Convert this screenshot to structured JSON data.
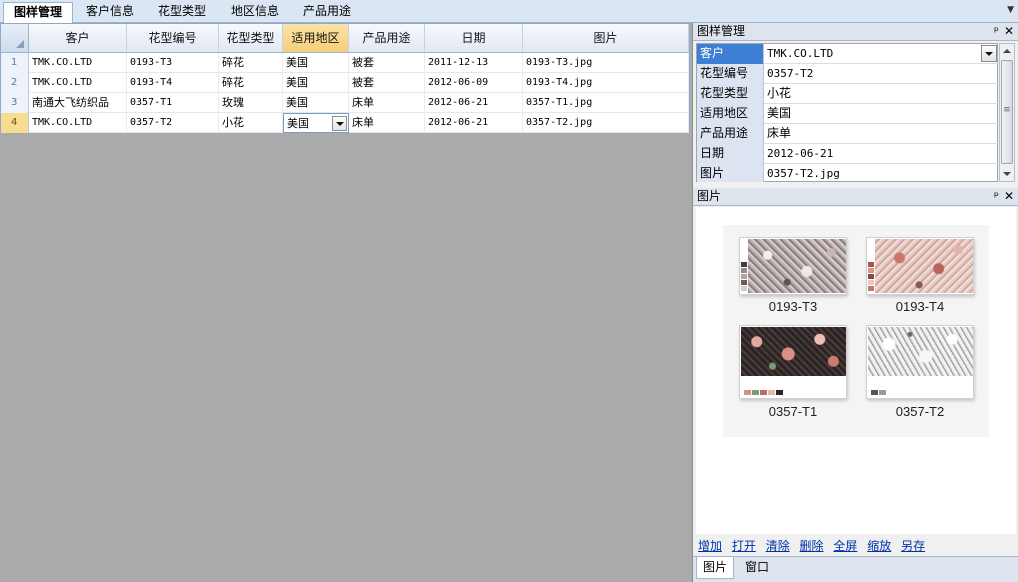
{
  "tabs": [
    {
      "label": "图样管理",
      "active": true
    },
    {
      "label": "客户信息",
      "active": false
    },
    {
      "label": "花型类型",
      "active": false
    },
    {
      "label": "地区信息",
      "active": false
    },
    {
      "label": "产品用途",
      "active": false
    }
  ],
  "tab_menu_icon": "chevron-down-icon",
  "grid": {
    "columns": [
      "客户",
      "花型编号",
      "花型类型",
      "适用地区",
      "产品用途",
      "日期",
      "图片"
    ],
    "selected_column": "适用地区",
    "current_row": 4,
    "rows": [
      {
        "num": "1",
        "cells": [
          "TMK.CO.LTD",
          "0193-T3",
          "碎花",
          "美国",
          "被套",
          "2011-12-13",
          "0193-T3.jpg"
        ]
      },
      {
        "num": "2",
        "cells": [
          "TMK.CO.LTD",
          "0193-T4",
          "碎花",
          "美国",
          "被套",
          "2012-06-09",
          "0193-T4.jpg"
        ]
      },
      {
        "num": "3",
        "cells": [
          "南通大飞纺织品",
          "0357-T1",
          "玫瑰",
          "美国",
          "床单",
          "2012-06-21",
          "0357-T1.jpg"
        ]
      },
      {
        "num": "4",
        "cells": [
          "TMK.CO.LTD",
          "0357-T2",
          "小花",
          "美国",
          "床单",
          "2012-06-21",
          "0357-T2.jpg"
        ]
      }
    ]
  },
  "props_panel": {
    "title": "图样管理",
    "pin_icon": "pin-icon",
    "close_icon": "close-icon",
    "items": [
      {
        "key": "客户",
        "value": "TMK.CO.LTD"
      },
      {
        "key": "花型编号",
        "value": "0357-T2"
      },
      {
        "key": "花型类型",
        "value": "小花"
      },
      {
        "key": "适用地区",
        "value": "美国"
      },
      {
        "key": "产品用途",
        "value": "床单"
      },
      {
        "key": "日期",
        "value": "2012-06-21"
      },
      {
        "key": "图片",
        "value": "0357-T2.jpg"
      }
    ]
  },
  "image_panel": {
    "title": "图片",
    "thumbnails": [
      {
        "caption": "0193-T3"
      },
      {
        "caption": "0193-T4"
      },
      {
        "caption": "0357-T1"
      },
      {
        "caption": "0357-T2"
      }
    ],
    "actions": [
      "增加",
      "打开",
      "清除",
      "删除",
      "全屏",
      "缩放",
      "另存"
    ]
  },
  "bottom_tabs": [
    {
      "label": "图片",
      "active": true
    },
    {
      "label": "窗口",
      "active": false
    }
  ],
  "colors": {
    "tabstrip_bg": "#dbe6f4",
    "workspace_bg": "#aaaaaa",
    "selected_header": "#f5cf7a",
    "current_row_marker": "#f8dc8f",
    "selected_prop": "#3d7fd2",
    "link": "#0033aa"
  }
}
